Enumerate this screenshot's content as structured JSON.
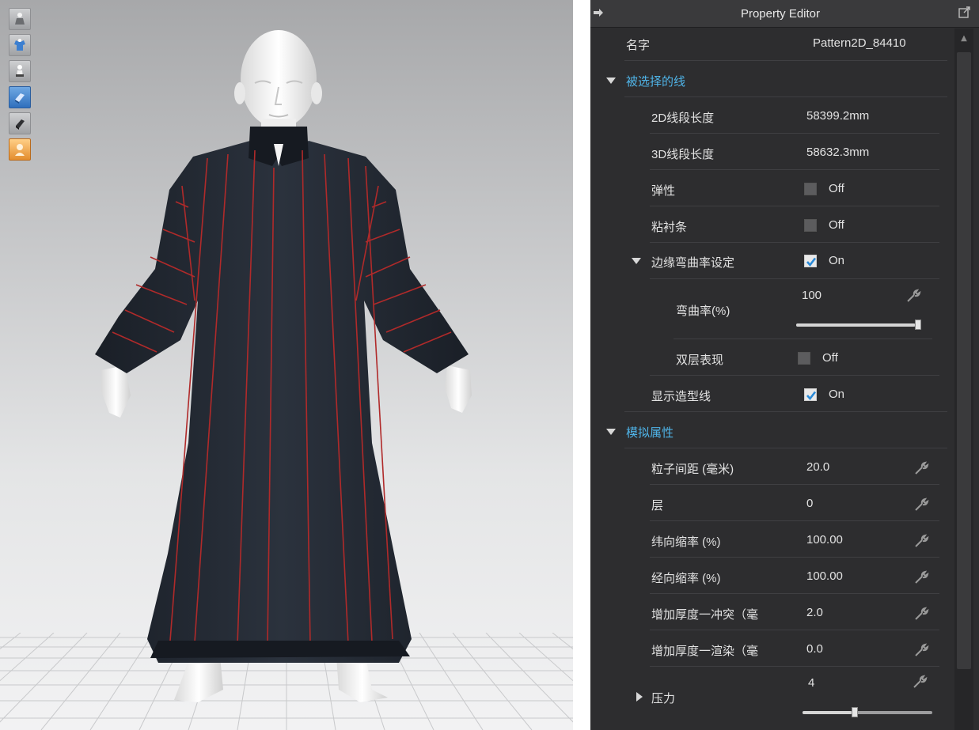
{
  "editor": {
    "title": "Property Editor",
    "name_label": "名字",
    "name_value": "Pattern2D_84410",
    "sections": {
      "selected_line": {
        "label": "被选择的线",
        "length_2d_label": "2D线段长度",
        "length_2d_value": "58399.2mm",
        "length_3d_label": "3D线段长度",
        "length_3d_value": "58632.3mm",
        "elastic_label": "弹性",
        "elastic_value": "Off",
        "fuse_label": "粘衬条",
        "fuse_value": "Off",
        "curvature_set_label": "边缘弯曲率设定",
        "curvature_set_value": "On",
        "curvature_label": "弯曲率(%)",
        "curvature_value": "100",
        "curvature_level": 1.0,
        "double_layer_label": "双层表现",
        "double_layer_value": "Off",
        "show_style_line_label": "显示造型线",
        "show_style_line_value": "On"
      },
      "simulation": {
        "label": "模拟属性",
        "particle_label": "粒子间距 (毫米)",
        "particle_value": "20.0",
        "layer_label": "层",
        "layer_value": "0",
        "weft_label": "纬向缩率 (%)",
        "weft_value": "100.00",
        "warp_label": "经向缩率 (%)",
        "warp_value": "100.00",
        "thickness_collision_label": "增加厚度一冲突（毫",
        "thickness_collision_value": "2.0",
        "thickness_render_label": "增加厚度一渲染（毫",
        "thickness_render_value": "0.0",
        "pressure_label": "压力",
        "pressure_value": "4",
        "pressure_level": 0.4
      }
    }
  },
  "colors": {
    "panel_bg": "#2d2d2f",
    "section_text": "#4fb4e8",
    "checkbox_check": "#2a8ad8",
    "garment": "#222832",
    "seam_line": "#b02a2a"
  },
  "toolbar_icons": [
    "avatar-garment-icon",
    "garment-icon",
    "avatar-icon",
    "pattern-view-icon",
    "texture-icon",
    "user-icon"
  ]
}
